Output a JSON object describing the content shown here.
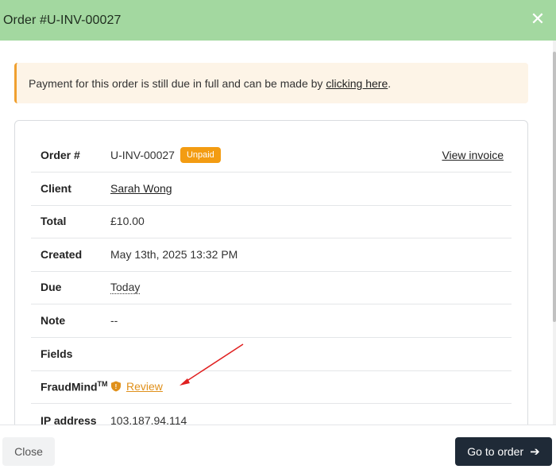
{
  "header": {
    "title": "Order #U-INV-00027",
    "close_icon": "close-icon"
  },
  "alert": {
    "text": "Payment for this order is still due in full and can be made by",
    "link": "clicking here",
    "suffix": "."
  },
  "order": {
    "rows": {
      "order_num": {
        "label": "Order #",
        "value": "U-INV-00027",
        "badge": "Unpaid",
        "action": "View invoice"
      },
      "client": {
        "label": "Client",
        "value": "Sarah Wong"
      },
      "total": {
        "label": "Total",
        "value": "£10.00"
      },
      "created": {
        "label": "Created",
        "value": "May 13th, 2025 13:32 PM"
      },
      "due": {
        "label": "Due",
        "value": "Today"
      },
      "note": {
        "label": "Note",
        "value": "--"
      },
      "fields": {
        "label": "Fields",
        "value": ""
      },
      "fraudmind": {
        "label": "FraudMind",
        "tm": "TM",
        "value": "Review",
        "icon": "shield-icon"
      },
      "ip": {
        "label": "IP address",
        "value": "103.187.94.114"
      }
    }
  },
  "footer": {
    "close_label": "Close",
    "go_label": "Go to order",
    "go_icon": "arrow-right-icon"
  },
  "colors": {
    "header_bg": "#a3d8a0",
    "badge": "#f39c12",
    "review": "#e0901a",
    "primary_button": "#1f2a37",
    "annotation": "#e02020"
  }
}
